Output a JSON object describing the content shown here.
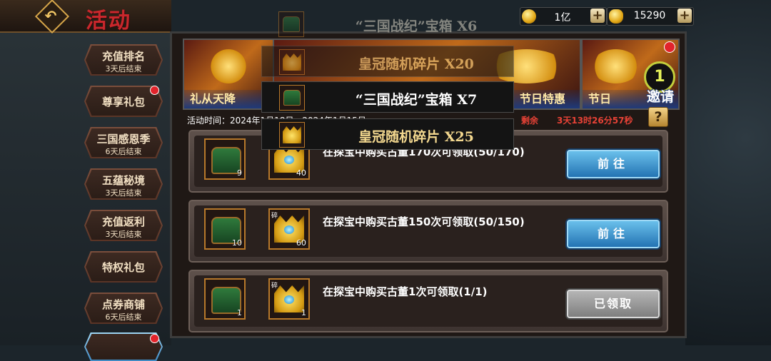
{
  "header": {
    "title": "活动"
  },
  "currency": [
    {
      "icon": "gold-coin-icon",
      "value": "1亿"
    },
    {
      "icon": "gold-ingot-icon",
      "value": "15290"
    }
  ],
  "sidebar": [
    {
      "label": "充值排名",
      "sub": "3天后结束",
      "dot": false
    },
    {
      "label": "尊享礼包",
      "sub": "",
      "dot": true
    },
    {
      "label": "三国感恩季",
      "sub": "6天后结束",
      "dot": false
    },
    {
      "label": "五蕴秘境",
      "sub": "3天后结束",
      "dot": false
    },
    {
      "label": "充值返利",
      "sub": "3天后结束",
      "dot": false
    },
    {
      "label": "特权礼包",
      "sub": "",
      "dot": false
    },
    {
      "label": "点券商铺",
      "sub": "6天后结束",
      "dot": false
    },
    {
      "label": "",
      "sub": "",
      "dot": true
    }
  ],
  "banners": {
    "b1": "礼从天降",
    "b2": "节日特惠",
    "b3": "节日",
    "invite_label": "邀请",
    "invite_count": "1"
  },
  "info": {
    "time_label": "活动时间：2024年1月18日 - 2024年1月15日",
    "remain_label": "剩余",
    "remain_value": "3天13时26分57秒"
  },
  "rows": [
    {
      "chest": "9",
      "crown": "40",
      "text": "在探宝中购买古董170次可领取(50/170)",
      "button": "前往"
    },
    {
      "chest": "10",
      "crown": "60",
      "text": "在探宝中购买古董150次可领取(50/150)",
      "button": "前往"
    },
    {
      "chest": "1",
      "crown": "1",
      "text": "在探宝中购买古董1次可领取(1/1)",
      "button": "已领取"
    }
  ],
  "frag_tag": "碎",
  "popup": [
    {
      "text": "“三国战纪”宝箱 X6"
    },
    {
      "text": "皇冠随机碎片 X20"
    },
    {
      "text": "“三国战纪”宝箱 X7"
    },
    {
      "text": "皇冠随机碎片 X25"
    }
  ]
}
